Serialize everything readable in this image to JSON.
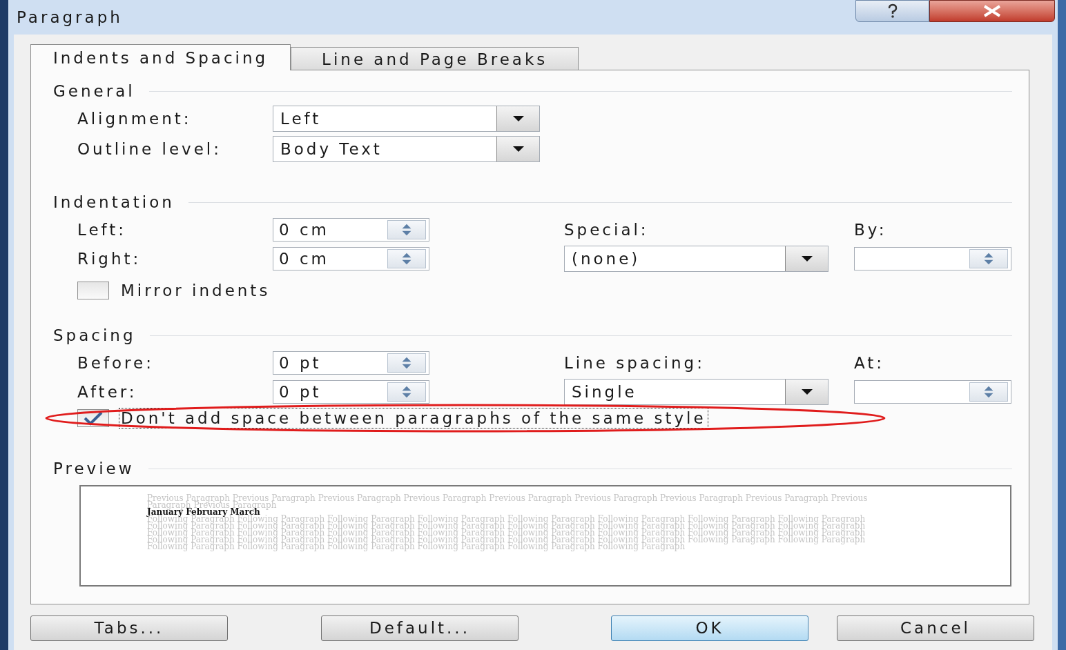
{
  "window": {
    "title": "Paragraph"
  },
  "tabs": [
    {
      "label": "Indents and Spacing",
      "selected": true
    },
    {
      "label": "Line and Page Breaks",
      "selected": false
    }
  ],
  "general": {
    "title": "General",
    "alignment": {
      "label": "Alignment:",
      "value": "Left"
    },
    "outline_level": {
      "label": "Outline level:",
      "value": "Body Text"
    }
  },
  "indentation": {
    "title": "Indentation",
    "left": {
      "label": "Left:",
      "value": "0 cm"
    },
    "right": {
      "label": "Right:",
      "value": "0 cm"
    },
    "special": {
      "label": "Special:",
      "value": "(none)"
    },
    "by": {
      "label": "By:"
    },
    "mirror_indents": {
      "label": "Mirror indents",
      "checked": false
    }
  },
  "spacing": {
    "title": "Spacing",
    "before": {
      "label": "Before:",
      "value": "0 pt"
    },
    "after": {
      "label": "After:",
      "value": "0 pt"
    },
    "line_spacing": {
      "label": "Line spacing:",
      "value": "Single"
    },
    "at": {
      "label": "At:"
    },
    "dont_add_space": {
      "label": "Don't add space between paragraphs of the same style",
      "checked": true,
      "focused": true,
      "highlighted": true
    }
  },
  "preview": {
    "title": "Preview",
    "previous_text": "Previous Paragraph Previous Paragraph Previous Paragraph Previous Paragraph Previous Paragraph Previous Paragraph Previous Paragraph Previous Paragraph Previous Paragraph Previous Paragraph",
    "sample_text": "January February March",
    "following_text": "Following Paragraph Following Paragraph Following Paragraph Following Paragraph Following Paragraph Following Paragraph Following Paragraph Following Paragraph Following Paragraph Following Paragraph Following Paragraph Following Paragraph Following Paragraph Following Paragraph Following Paragraph Following Paragraph Following Paragraph Following Paragraph Following Paragraph Following Paragraph Following Paragraph Following Paragraph Following Paragraph Following Paragraph Following Paragraph Following Paragraph Following Paragraph Following Paragraph Following Paragraph Following Paragraph Following Paragraph Following Paragraph Following Paragraph Following Paragraph Following Paragraph Following Paragraph Following Paragraph Following Paragraph"
  },
  "buttons": [
    {
      "label": "Tabs...",
      "default": false
    },
    {
      "label": "Default...",
      "default": false
    },
    {
      "label": "OK",
      "default": true
    },
    {
      "label": "Cancel",
      "default": false
    }
  ]
}
